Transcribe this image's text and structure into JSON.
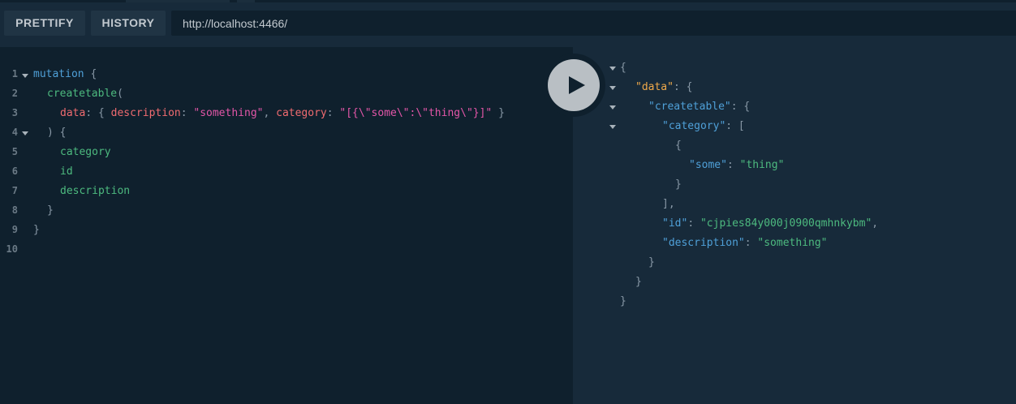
{
  "toolbar": {
    "prettify_label": "PRETTIFY",
    "history_label": "HISTORY",
    "endpoint_url": "http://localhost:4466/"
  },
  "editor": {
    "line_numbers": [
      "1",
      "2",
      "3",
      "4",
      "5",
      "6",
      "7",
      "8",
      "9",
      "10"
    ],
    "lines": {
      "l1_kw": "mutation",
      "l1_brace": " {",
      "l2_field": "createtable",
      "l2_paren": "(",
      "l3_arg": "data",
      "l3_colon": ": { ",
      "l3_arg2": "description",
      "l3_colon2": ": ",
      "l3_str": "\"something\"",
      "l3_comma": ", ",
      "l3_arg3": "category",
      "l3_colon3": ": ",
      "l3_str2": "\"[{\\\"some\\\":\\\"thing\\\"}]\"",
      "l3_close": " }",
      "l4": ") {",
      "l5_field": "category",
      "l6_field": "id",
      "l7_field": "description",
      "l8": "}",
      "l9": "}"
    }
  },
  "result": {
    "open": "{",
    "data_key": "\"data\"",
    "data_open": ": {",
    "createtable_key": "\"createtable\"",
    "createtable_open": ": {",
    "category_key": "\"category\"",
    "category_open": ": [",
    "obj_open": "{",
    "some_key": "\"some\"",
    "some_sep": ": ",
    "some_val": "\"thing\"",
    "obj_close": "}",
    "array_close": "],",
    "id_key": "\"id\"",
    "id_sep": ": ",
    "id_val": "\"cjpies84y000j0900qmhnkybm\"",
    "id_comma": ",",
    "desc_key": "\"description\"",
    "desc_sep": ": ",
    "desc_val": "\"something\"",
    "close1": "}",
    "close2": "}",
    "close3": "}"
  },
  "colors": {
    "background": "#172a3a",
    "editor_bg": "#0f202d",
    "keyword": "#4fa0d8",
    "field": "#4dba7f",
    "argument": "#f06b70",
    "string": "#e356a8",
    "result_top_key": "#f0a94a"
  },
  "icons": {
    "run": "play-icon",
    "fold": "caret-down-icon"
  }
}
